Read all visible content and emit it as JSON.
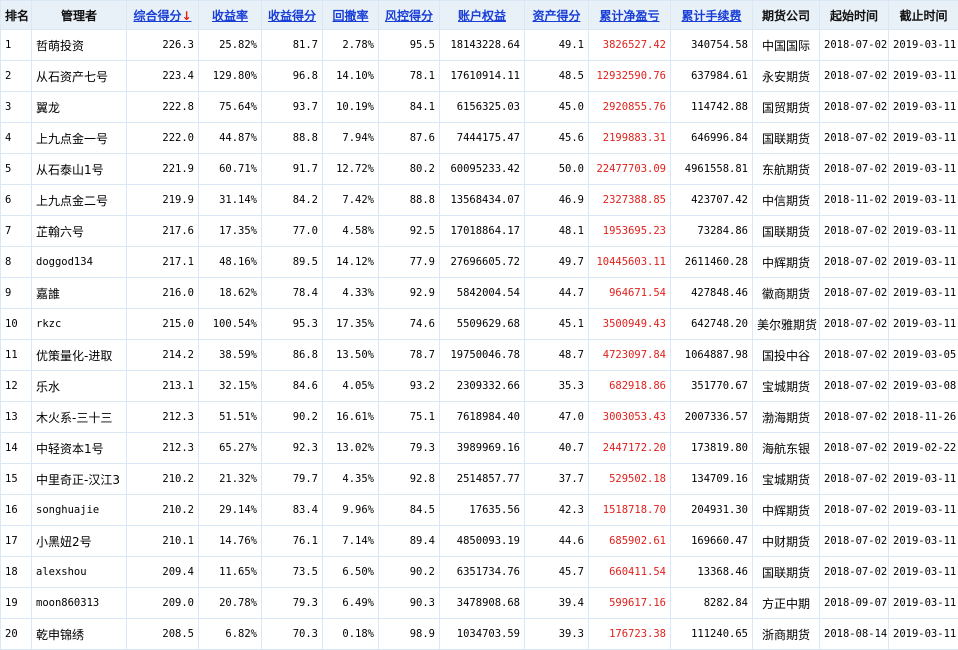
{
  "headers": [
    {
      "key": "rank",
      "label": "排名",
      "sortable": false
    },
    {
      "key": "manager",
      "label": "管理者",
      "sortable": false
    },
    {
      "key": "total_score",
      "label": "综合得分",
      "sortable": true,
      "sorted": "desc",
      "sort_glyph": "↓"
    },
    {
      "key": "return_rate",
      "label": "收益率",
      "sortable": true
    },
    {
      "key": "return_score",
      "label": "收益得分",
      "sortable": true
    },
    {
      "key": "drawdown",
      "label": "回撤率",
      "sortable": true
    },
    {
      "key": "risk_score",
      "label": "风控得分",
      "sortable": true
    },
    {
      "key": "equity",
      "label": "账户权益",
      "sortable": true
    },
    {
      "key": "asset_score",
      "label": "资产得分",
      "sortable": true
    },
    {
      "key": "net_pnl",
      "label": "累计净盈亏",
      "sortable": true
    },
    {
      "key": "fees",
      "label": "累计手续费",
      "sortable": true
    },
    {
      "key": "broker",
      "label": "期货公司",
      "sortable": false
    },
    {
      "key": "start",
      "label": "起始时间",
      "sortable": false
    },
    {
      "key": "end",
      "label": "截止时间",
      "sortable": false
    }
  ],
  "rows": [
    [
      "1",
      "哲萌投资",
      "226.3",
      "25.82%",
      "81.7",
      "2.78%",
      "95.5",
      "18143228.64",
      "49.1",
      "3826527.42",
      "340754.58",
      "中国国际",
      "2018-07-02",
      "2019-03-11"
    ],
    [
      "2",
      "从石资产七号",
      "223.4",
      "129.80%",
      "96.8",
      "14.10%",
      "78.1",
      "17610914.11",
      "48.5",
      "12932590.76",
      "637984.61",
      "永安期货",
      "2018-07-02",
      "2019-03-11"
    ],
    [
      "3",
      "翼龙",
      "222.8",
      "75.64%",
      "93.7",
      "10.19%",
      "84.1",
      "6156325.03",
      "45.0",
      "2920855.76",
      "114742.88",
      "国贸期货",
      "2018-07-02",
      "2019-03-11"
    ],
    [
      "4",
      "上九点金一号",
      "222.0",
      "44.87%",
      "88.8",
      "7.94%",
      "87.6",
      "7444175.47",
      "45.6",
      "2199883.31",
      "646996.84",
      "国联期货",
      "2018-07-02",
      "2019-03-11"
    ],
    [
      "5",
      "从石泰山1号",
      "221.9",
      "60.71%",
      "91.7",
      "12.72%",
      "80.2",
      "60095233.42",
      "50.0",
      "22477703.09",
      "4961558.81",
      "东航期货",
      "2018-07-02",
      "2019-03-11"
    ],
    [
      "6",
      "上九点金二号",
      "219.9",
      "31.14%",
      "84.2",
      "7.42%",
      "88.8",
      "13568434.07",
      "46.9",
      "2327388.85",
      "423707.42",
      "中信期货",
      "2018-11-02",
      "2019-03-11"
    ],
    [
      "7",
      "芷翰六号",
      "217.6",
      "17.35%",
      "77.0",
      "4.58%",
      "92.5",
      "17018864.17",
      "48.1",
      "1953695.23",
      "73284.86",
      "国联期货",
      "2018-07-02",
      "2019-03-11"
    ],
    [
      "8",
      "doggod134",
      "217.1",
      "48.16%",
      "89.5",
      "14.12%",
      "77.9",
      "27696605.72",
      "49.7",
      "10445603.11",
      "2611460.28",
      "中辉期货",
      "2018-07-02",
      "2019-03-11"
    ],
    [
      "9",
      "嘉誰",
      "216.0",
      "18.62%",
      "78.4",
      "4.33%",
      "92.9",
      "5842004.54",
      "44.7",
      "964671.54",
      "427848.46",
      "徽商期货",
      "2018-07-02",
      "2019-03-11"
    ],
    [
      "10",
      "rkzc",
      "215.0",
      "100.54%",
      "95.3",
      "17.35%",
      "74.6",
      "5509629.68",
      "45.1",
      "3500949.43",
      "642748.20",
      "美尔雅期货",
      "2018-07-02",
      "2019-03-11"
    ],
    [
      "11",
      "优策量化-进取",
      "214.2",
      "38.59%",
      "86.8",
      "13.50%",
      "78.7",
      "19750046.78",
      "48.7",
      "4723097.84",
      "1064887.98",
      "国投中谷",
      "2018-07-02",
      "2019-03-05"
    ],
    [
      "12",
      "乐水",
      "213.1",
      "32.15%",
      "84.6",
      "4.05%",
      "93.2",
      "2309332.66",
      "35.3",
      "682918.86",
      "351770.67",
      "宝城期货",
      "2018-07-02",
      "2019-03-08"
    ],
    [
      "13",
      "木火系-三十三",
      "212.3",
      "51.51%",
      "90.2",
      "16.61%",
      "75.1",
      "7618984.40",
      "47.0",
      "3003053.43",
      "2007336.57",
      "渤海期货",
      "2018-07-02",
      "2018-11-26"
    ],
    [
      "14",
      "中轻资本1号",
      "212.3",
      "65.27%",
      "92.3",
      "13.02%",
      "79.3",
      "3989969.16",
      "40.7",
      "2447172.20",
      "173819.80",
      "海航东银",
      "2018-07-02",
      "2019-02-22"
    ],
    [
      "15",
      "中里奇正-汉江3",
      "210.2",
      "21.32%",
      "79.7",
      "4.35%",
      "92.8",
      "2514857.77",
      "37.7",
      "529502.18",
      "134709.16",
      "宝城期货",
      "2018-07-02",
      "2019-03-11"
    ],
    [
      "16",
      "songhuajie",
      "210.2",
      "29.14%",
      "83.4",
      "9.96%",
      "84.5",
      "17635.56",
      "42.3",
      "1518718.70",
      "204931.30",
      "中辉期货",
      "2018-07-02",
      "2019-03-11"
    ],
    [
      "17",
      "小黑妞2号",
      "210.1",
      "14.76%",
      "76.1",
      "7.14%",
      "89.4",
      "4850093.19",
      "44.6",
      "685902.61",
      "169660.47",
      "中财期货",
      "2018-07-02",
      "2019-03-11"
    ],
    [
      "18",
      "alexshou",
      "209.4",
      "11.65%",
      "73.5",
      "6.50%",
      "90.2",
      "6351734.76",
      "45.7",
      "660411.54",
      "13368.46",
      "国联期货",
      "2018-07-02",
      "2019-03-11"
    ],
    [
      "19",
      "moon860313",
      "209.0",
      "20.78%",
      "79.3",
      "6.49%",
      "90.3",
      "3478908.68",
      "39.4",
      "599617.16",
      "8282.84",
      "方正中期",
      "2018-09-07",
      "2019-03-11"
    ],
    [
      "20",
      "乾申锦绣",
      "208.5",
      "6.82%",
      "70.3",
      "0.18%",
      "98.9",
      "1034703.59",
      "39.3",
      "176723.38",
      "111240.65",
      "浙商期货",
      "2018-08-14",
      "2019-03-11"
    ]
  ],
  "colors": {
    "header_bg": "#e9f1f8",
    "border": "#d9e8f4",
    "link_blue": "#1a3fd6",
    "pnl_red": "#e0201c"
  }
}
